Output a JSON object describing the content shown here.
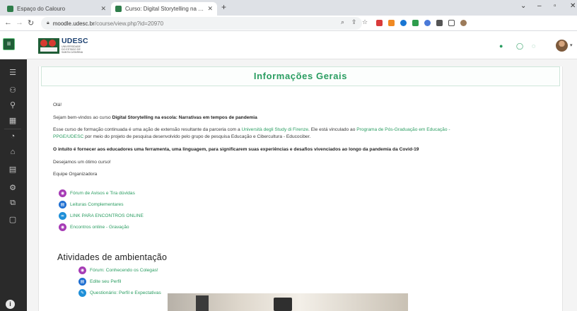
{
  "browser": {
    "tabs": [
      {
        "title": "Espaço do Calouro",
        "active": false,
        "color": "#2e7d4a"
      },
      {
        "title": "Curso: Digital Storytelling na Esc",
        "active": true,
        "color": "#2e7d4a"
      }
    ],
    "new_tab": "+",
    "url_host": "moodle.udesc.br",
    "url_path": "/course/view.php?id=20970"
  },
  "navbar": {
    "logo_name": "UDESC",
    "logo_sub": [
      "UNIVERSIDADE",
      "DO ESTADO DE",
      "SANTA CATARINA"
    ]
  },
  "section": {
    "title": "Informações Gerais",
    "greeting": "Olá!",
    "welcome_prefix": "Sejam bem-vindos ao curso ",
    "welcome_bold": "Digital Storytelling na escola: Narrativas em tempos de pandemia",
    "para1_a": "Esse curso de formação continuada é uma ação de extensão resultante da parceria com a ",
    "para1_link1": "Università degli Study di Firenze",
    "para1_b": ". Ele está vinculado ao ",
    "para1_link2": "Programa de Pós-Graduação em Educação -",
    "para1_link3": "PPGE/UDESC",
    "para1_c": " por meio do projeto de pesquisa desenvolvido pelo grupo de pesquisa Educação e Cibercultura - Educociber.",
    "intent": "O intuito é fornecer aos educadores uma ferramenta, uma linguagem, para significarem suas experiências e desafios vivenciados ao longo da pandemia da Covid-19",
    "wish": "Desejamos um ótimo curso!",
    "team": "Equipe Organizadora",
    "activities": [
      {
        "label": "Fórum de Avisos e Tira dúvidas",
        "type": "forum"
      },
      {
        "label": "Leituras Complementares",
        "type": "page"
      },
      {
        "label": "LINK PARA ENCONTROS ONLINE",
        "type": "url"
      },
      {
        "label": "Encontros online - Gravação",
        "type": "forum"
      }
    ]
  },
  "ambientacao": {
    "title": "Atividades de ambientação",
    "activities": [
      {
        "label": "Fórum: Conhecendo os Colegas!",
        "type": "forum"
      },
      {
        "label": "Edite seu Perfil",
        "type": "page"
      },
      {
        "label": "Questionário: Perfil e Expectativas",
        "type": "url"
      }
    ]
  },
  "colors": {
    "brand_green": "#2a9d61",
    "drawer": "#2a2a2a",
    "forum": "#a63bb5",
    "page": "#1f6fd1"
  }
}
